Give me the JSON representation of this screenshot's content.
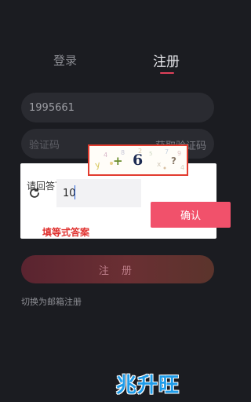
{
  "tabs": {
    "login": "登录",
    "register": "注册"
  },
  "form": {
    "phone_value": "1995661",
    "code_placeholder": "验证码",
    "get_code": "获取验证码",
    "submit": "注 册",
    "switch_email": "切换为邮箱注册"
  },
  "captcha": {
    "question": "请回答下列问",
    "operator": "+",
    "digit": "6",
    "tail": "?",
    "answer_value": "10",
    "confirm": "确认",
    "hint": "填等式答案"
  },
  "watermark": "兆升旺",
  "colors": {
    "accent": "#f1516b",
    "highlight_border": "#e23b2e",
    "watermark": "#1e9be8"
  },
  "icons": {
    "refresh": "refresh-icon"
  }
}
